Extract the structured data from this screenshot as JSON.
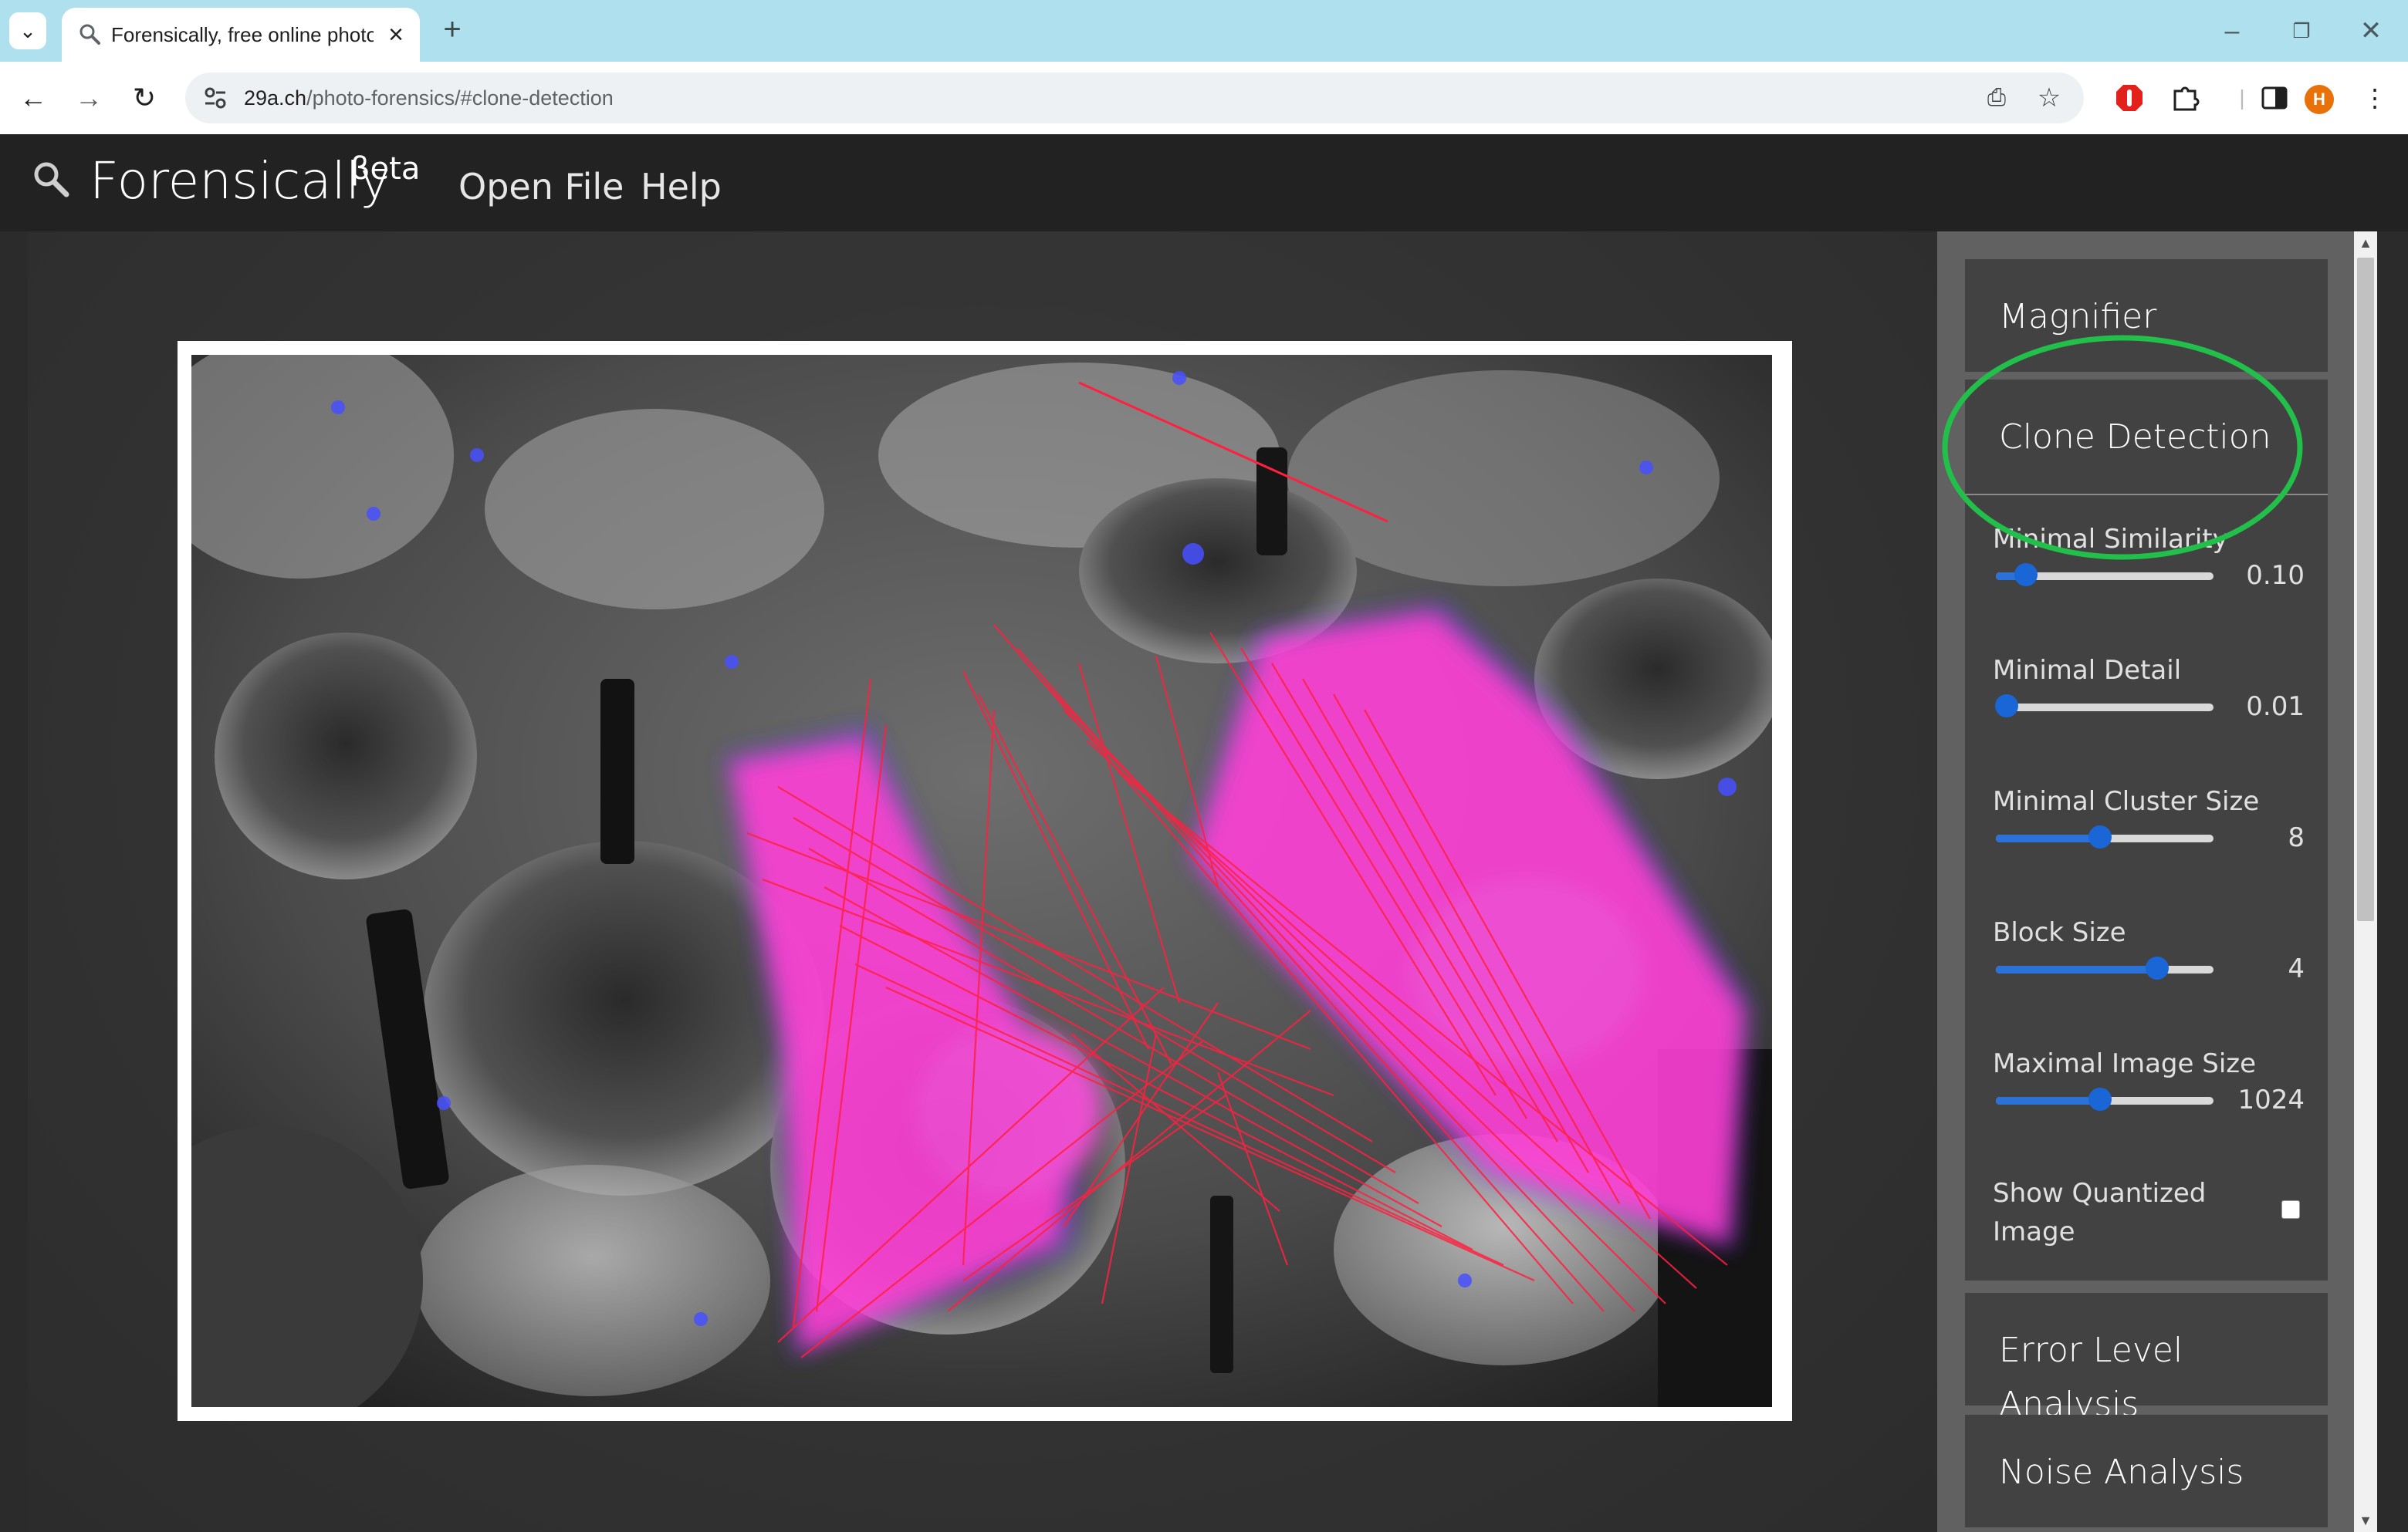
{
  "browser": {
    "tab_title": "Forensically, free online photo f",
    "url_host": "29a.ch",
    "url_path": "/photo-forensics/#clone-detection",
    "icons": [
      "tab-list-icon",
      "search-icon",
      "close-icon",
      "plus-icon",
      "minimize-icon",
      "restore-icon",
      "close-window-icon",
      "back-arrow-icon",
      "forward-arrow-icon",
      "reload-icon",
      "site-settings-icon",
      "install-app-icon",
      "star-icon",
      "adblock-icon",
      "extensions-icon",
      "side-panel-icon",
      "profile-avatar",
      "more-vert-icon"
    ],
    "avatar_letter": "H"
  },
  "app": {
    "name": "Forensically",
    "beta": "βeta",
    "nav": {
      "open_file": "Open File",
      "help": "Help"
    }
  },
  "sidebar": {
    "magnifier": "Magnifier",
    "clone_detection": "Clone Detection",
    "settings": {
      "min_similarity": {
        "label": "Minimal Similarity",
        "value": "0.10",
        "fraction": 0.14
      },
      "min_detail": {
        "label": "Minimal Detail",
        "value": "0.01",
        "fraction": 0.05
      },
      "min_cluster": {
        "label": "Minimal Cluster Size",
        "value": "8",
        "fraction": 0.48
      },
      "block_size": {
        "label": "Block Size",
        "value": "4",
        "fraction": 0.74
      },
      "max_image_size": {
        "label": "Maximal Image Size",
        "value": "1024",
        "fraction": 0.48
      },
      "show_quantized": {
        "label": "Show Quantized Image",
        "checked": false
      }
    },
    "error_level": "Error Level Analysis",
    "noise": "Noise Analysis"
  },
  "colors": {
    "chrome_tabbar": "#afe0ed",
    "app_header": "#222222",
    "slider_accent": "#1a66d6",
    "clone_highlight": "#ff3fd8",
    "clone_lines": "#ff2040",
    "annotation_circle": "#22c04a"
  }
}
